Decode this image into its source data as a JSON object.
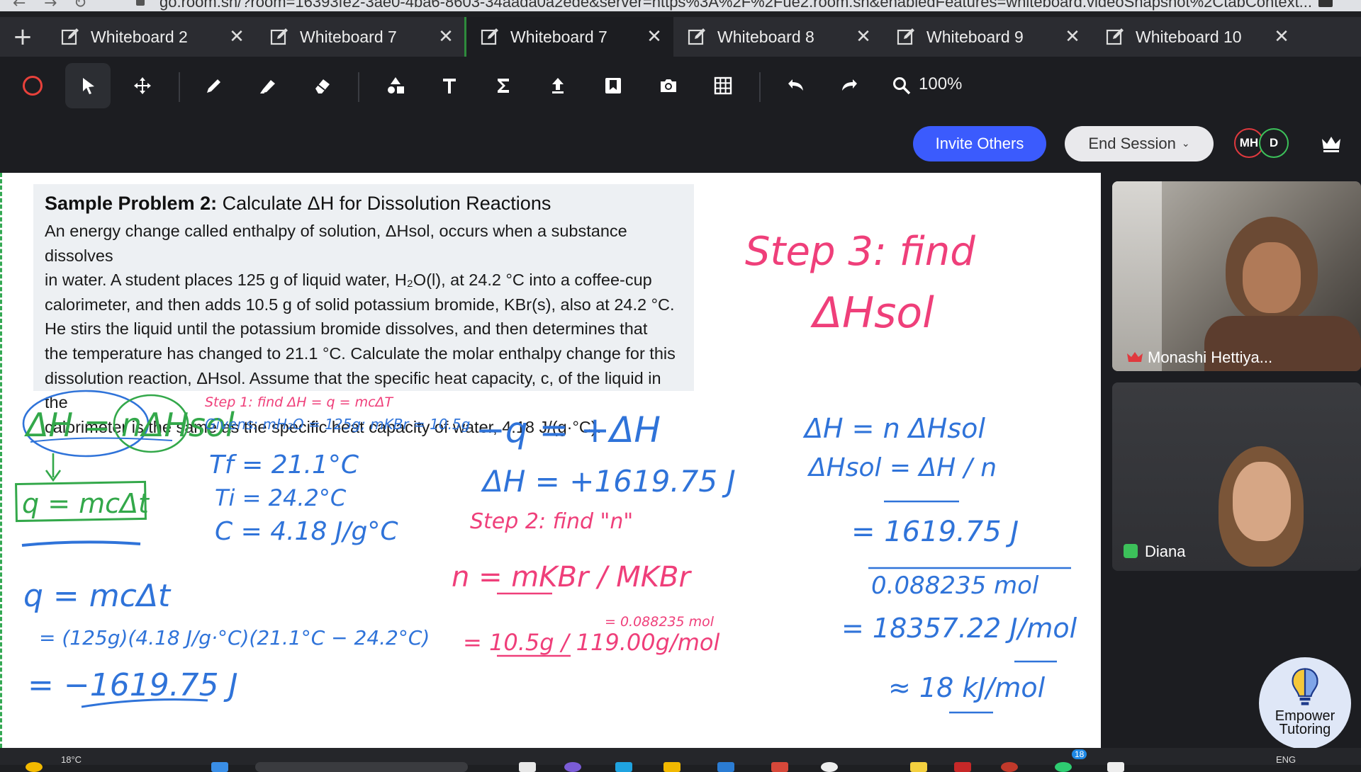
{
  "browser": {
    "url": "go.room.sh/?room=16393fe2-3ae0-4ba6-8603-34aada0a2ede&server=https%3A%2F%2Fue2.room.sh&enabledFeatures=whiteboard.videoSnapshot%2CtabContext..."
  },
  "tabs": [
    {
      "label": "Whiteboard 2",
      "active": false
    },
    {
      "label": "Whiteboard 7",
      "active": false
    },
    {
      "label": "Whiteboard 7",
      "active": true
    },
    {
      "label": "Whiteboard 8",
      "active": false
    },
    {
      "label": "Whiteboard 9",
      "active": false
    },
    {
      "label": "Whiteboard 10",
      "active": false
    }
  ],
  "toolbar": {
    "zoom": "100%",
    "tools": [
      "record-icon",
      "select-icon",
      "move-icon",
      "pen-icon",
      "highlighter-icon",
      "eraser-icon",
      "shapes-icon",
      "text-icon",
      "formula-icon",
      "upload-icon",
      "bookmark-icon",
      "camera-icon",
      "grid-icon",
      "undo-icon",
      "redo-icon",
      "zoom-icon"
    ]
  },
  "session": {
    "invite_label": "Invite Others",
    "end_label": "End Session",
    "avatars": [
      {
        "initials": "MH",
        "color": "#e0393e"
      },
      {
        "initials": "D",
        "color": "#3cc15a"
      }
    ]
  },
  "problem": {
    "title_bold": "Sample Problem 2:",
    "title_rest": "Calculate ΔH for Dissolution Reactions",
    "lines": [
      "An energy change called enthalpy of solution, ΔHsol, occurs when a substance dissolves",
      "in water. A student places 125 g of liquid water, H₂O(l), at 24.2 °C into a coffee-cup",
      "calorimeter, and then adds 10.5 g of solid potassium bromide, KBr(s), also at 24.2 °C.",
      "He stirs the liquid until the potassium bromide dissolves, and then determines that",
      "the temperature has changed to 21.1 °C. Calculate the molar enthalpy change for this",
      "dissolution reaction, ΔHsol. Assume that the specific heat capacity, c, of the liquid in the",
      "calorimeter is the same as the specific heat capacity of water, 4.18 J/(g·°C)."
    ]
  },
  "ink": {
    "blue": "#2f73d9",
    "pink": "#ef3f7a",
    "green": "#33a84a",
    "notes": [
      {
        "id": "eq-main",
        "color": "green",
        "text": "ΔH = nΔHsol"
      },
      {
        "id": "eq-q",
        "color": "green",
        "text": "q = mcΔt"
      },
      {
        "id": "step1",
        "color": "pink",
        "text": "Step 1: find ΔH = q = mcΔT"
      },
      {
        "id": "givens",
        "color": "blue",
        "text": "Givens: mH₂O = 125g; mKBr = 10.5g"
      },
      {
        "id": "tf",
        "color": "blue",
        "text": "Tf = 21.1°C"
      },
      {
        "id": "ti",
        "color": "blue",
        "text": "Ti = 24.2°C"
      },
      {
        "id": "c",
        "color": "blue",
        "text": "C = 4.18 J/g°C"
      },
      {
        "id": "q1",
        "color": "blue",
        "text": "q = mcΔt"
      },
      {
        "id": "q2",
        "color": "blue",
        "text": "= (125g)(4.18 J/g·°C)(21.1°C − 24.2°C)"
      },
      {
        "id": "q3",
        "color": "blue",
        "text": "= −1619.75 J"
      },
      {
        "id": "mid1",
        "color": "blue",
        "text": "−q = +ΔH"
      },
      {
        "id": "mid2",
        "color": "blue",
        "text": "ΔH = +1619.75 J"
      },
      {
        "id": "step2",
        "color": "pink",
        "text": "Step 2: find \"n\""
      },
      {
        "id": "n1",
        "color": "pink",
        "text": "n = mKBr / MKBr"
      },
      {
        "id": "n2",
        "color": "pink",
        "text": "= 10.5g / 119.00g/mol"
      },
      {
        "id": "n3",
        "color": "pink",
        "text": "= 0.088235 mol"
      },
      {
        "id": "step3a",
        "color": "pink",
        "text": "Step 3: find"
      },
      {
        "id": "step3b",
        "color": "pink",
        "text": "ΔHsol"
      },
      {
        "id": "r1",
        "color": "blue",
        "text": "ΔH = n ΔHsol"
      },
      {
        "id": "r2",
        "color": "blue",
        "text": "ΔHsol = ΔH / n"
      },
      {
        "id": "r3",
        "color": "blue",
        "text": "= 1619.75 J"
      },
      {
        "id": "r4",
        "color": "blue",
        "text": "0.088235 mol"
      },
      {
        "id": "r5",
        "color": "blue",
        "text": "= 18357.22 J/mol"
      },
      {
        "id": "r6",
        "color": "blue",
        "text": "≈ 18 kJ/mol"
      }
    ]
  },
  "participants": [
    {
      "name": "Monashi Hettiya...",
      "host": true
    },
    {
      "name": "Diana",
      "host": false
    }
  ],
  "brand": {
    "line1": "Empower",
    "line2": "Tutoring"
  },
  "taskbar": {
    "weather": "18°C",
    "lang": "ENG",
    "badge": "18"
  }
}
